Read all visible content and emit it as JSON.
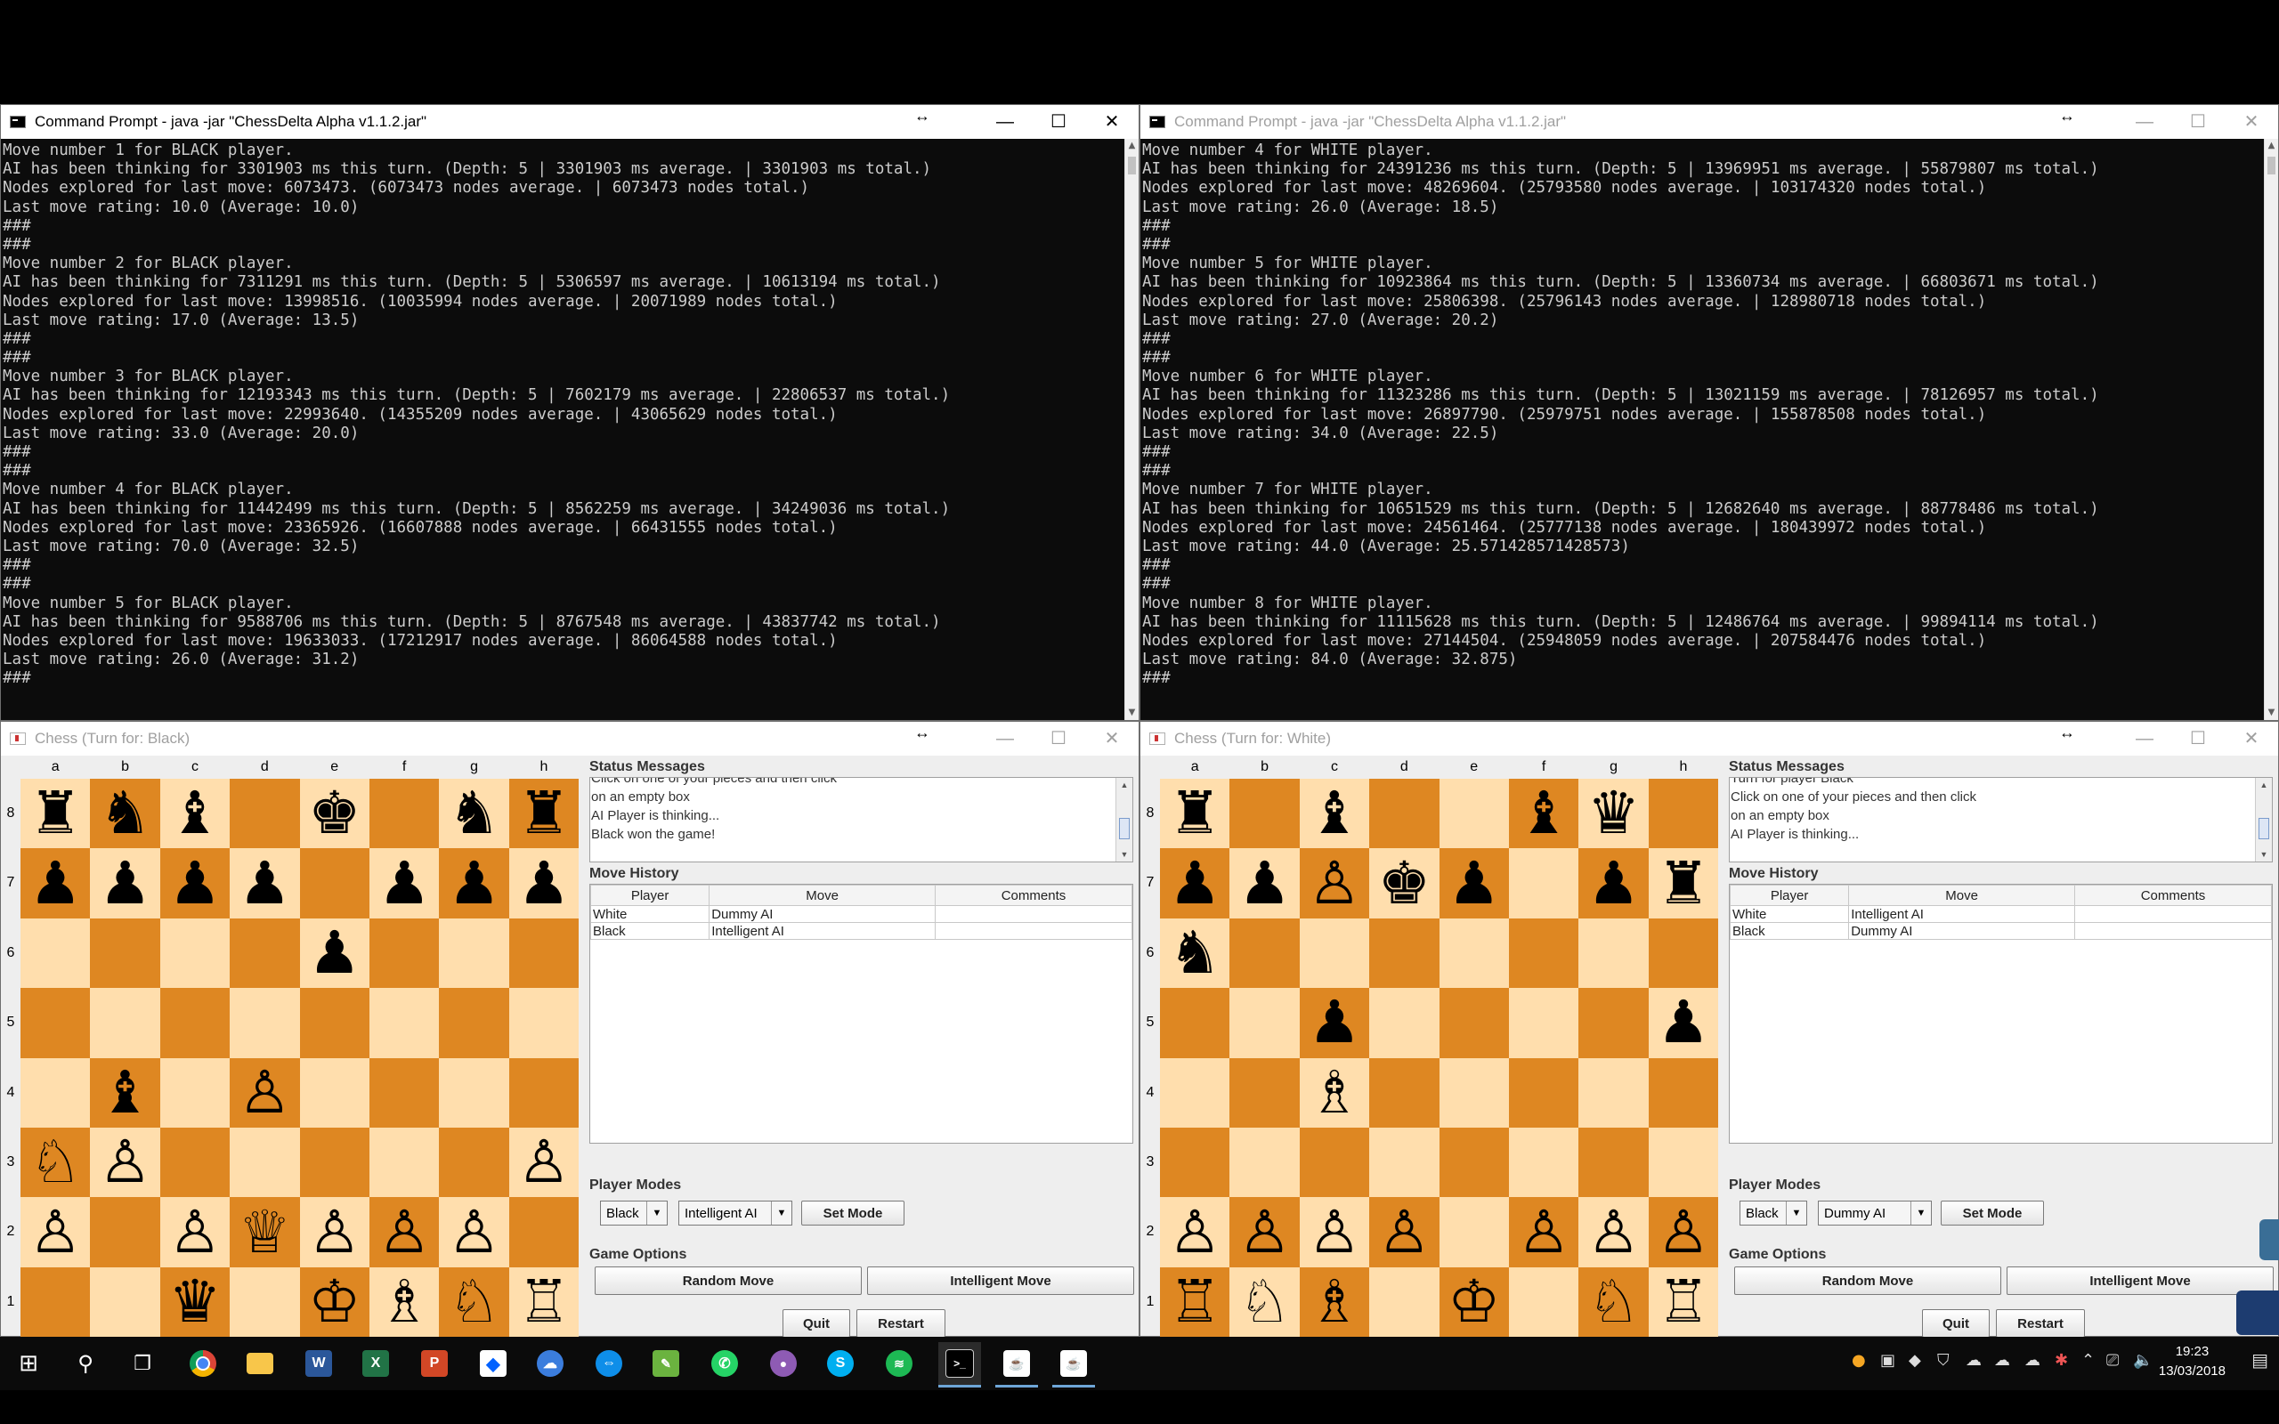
{
  "console_left": {
    "title": "Command Prompt - java  -jar \"ChessDelta Alpha v1.1.2.jar\"",
    "lines": [
      "Move number 1 for BLACK player.",
      "AI has been thinking for 3301903 ms this turn. (Depth: 5 | 3301903 ms average. | 3301903 ms total.)",
      "Nodes explored for last move: 6073473. (6073473 nodes average. | 6073473 nodes total.)",
      "Last move rating: 10.0 (Average: 10.0)",
      "###",
      "###",
      "Move number 2 for BLACK player.",
      "AI has been thinking for 7311291 ms this turn. (Depth: 5 | 5306597 ms average. | 10613194 ms total.)",
      "Nodes explored for last move: 13998516. (10035994 nodes average. | 20071989 nodes total.)",
      "Last move rating: 17.0 (Average: 13.5)",
      "###",
      "###",
      "Move number 3 for BLACK player.",
      "AI has been thinking for 12193343 ms this turn. (Depth: 5 | 7602179 ms average. | 22806537 ms total.)",
      "Nodes explored for last move: 22993640. (14355209 nodes average. | 43065629 nodes total.)",
      "Last move rating: 33.0 (Average: 20.0)",
      "###",
      "###",
      "Move number 4 for BLACK player.",
      "AI has been thinking for 11442499 ms this turn. (Depth: 5 | 8562259 ms average. | 34249036 ms total.)",
      "Nodes explored for last move: 23365926. (16607888 nodes average. | 66431555 nodes total.)",
      "Last move rating: 70.0 (Average: 32.5)",
      "###",
      "###",
      "Move number 5 for BLACK player.",
      "AI has been thinking for 9588706 ms this turn. (Depth: 5 | 8767548 ms average. | 43837742 ms total.)",
      "Nodes explored for last move: 19633033. (17212917 nodes average. | 86064588 nodes total.)",
      "Last move rating: 26.0 (Average: 31.2)",
      "###"
    ]
  },
  "console_right": {
    "title": "Command Prompt - java  -jar \"ChessDelta Alpha v1.1.2.jar\"",
    "lines": [
      "Move number 4 for WHITE player.",
      "AI has been thinking for 24391236 ms this turn. (Depth: 5 | 13969951 ms average. | 55879807 ms total.)",
      "Nodes explored for last move: 48269604. (25793580 nodes average. | 103174320 nodes total.)",
      "Last move rating: 26.0 (Average: 18.5)",
      "###",
      "###",
      "Move number 5 for WHITE player.",
      "AI has been thinking for 10923864 ms this turn. (Depth: 5 | 13360734 ms average. | 66803671 ms total.)",
      "Nodes explored for last move: 25806398. (25796143 nodes average. | 128980718 nodes total.)",
      "Last move rating: 27.0 (Average: 20.2)",
      "###",
      "###",
      "Move number 6 for WHITE player.",
      "AI has been thinking for 11323286 ms this turn. (Depth: 5 | 13021159 ms average. | 78126957 ms total.)",
      "Nodes explored for last move: 26897790. (25979751 nodes average. | 155878508 nodes total.)",
      "Last move rating: 34.0 (Average: 22.5)",
      "###",
      "###",
      "Move number 7 for WHITE player.",
      "AI has been thinking for 10651529 ms this turn. (Depth: 5 | 12682640 ms average. | 88778486 ms total.)",
      "Nodes explored for last move: 24561464. (25777138 nodes average. | 180439972 nodes total.)",
      "Last move rating: 44.0 (Average: 25.571428571428573)",
      "###",
      "###",
      "Move number 8 for WHITE player.",
      "AI has been thinking for 11115628 ms this turn. (Depth: 5 | 12486764 ms average. | 99894114 ms total.)",
      "Nodes explored for last move: 27144504. (25948059 nodes average. | 207584476 nodes total.)",
      "Last move rating: 84.0 (Average: 32.875)",
      "###"
    ]
  },
  "files": [
    "a",
    "b",
    "c",
    "d",
    "e",
    "f",
    "g",
    "h"
  ],
  "ranks": [
    "8",
    "7",
    "6",
    "5",
    "4",
    "3",
    "2",
    "1"
  ],
  "chess_left": {
    "title": "Chess (Turn for: Black)",
    "board": [
      [
        "♜",
        "♞",
        "♝",
        "",
        "♚",
        "",
        "♞",
        "♜"
      ],
      [
        "♟",
        "♟",
        "♟",
        "♟",
        "",
        "♟",
        "♟",
        "♟"
      ],
      [
        "",
        "",
        "",
        "",
        "♟",
        "",
        "",
        ""
      ],
      [
        "",
        "",
        "",
        "",
        "",
        "",
        "",
        ""
      ],
      [
        "",
        "♝",
        "",
        "♙",
        "",
        "",
        "",
        ""
      ],
      [
        "♘",
        "♙",
        "",
        "",
        "",
        "",
        "",
        "♙"
      ],
      [
        "♙",
        "",
        "♙",
        "♕",
        "♙",
        "♙",
        "♙",
        ""
      ],
      [
        "",
        "",
        "♛",
        "",
        "♔",
        "♗",
        "♘",
        "♖"
      ]
    ],
    "status_title": "Status Messages",
    "status_messages": [
      "Click on one of your pieces and then click",
      "on an empty box",
      "AI Player is thinking...",
      "Black won the game!"
    ],
    "history_title": "Move History",
    "history_headers": [
      "Player",
      "Move",
      "Comments"
    ],
    "history_rows": [
      [
        "White",
        "Dummy AI",
        ""
      ],
      [
        "Black",
        "Intelligent AI",
        ""
      ]
    ],
    "player_modes_title": "Player Modes",
    "player_select": "Black",
    "mode_select": "Intelligent AI",
    "set_mode": "Set Mode",
    "game_options_title": "Game Options",
    "random_move": "Random Move",
    "intelligent_move": "Intelligent Move",
    "quit": "Quit",
    "restart": "Restart"
  },
  "chess_right": {
    "title": "Chess (Turn for: White)",
    "board": [
      [
        "♜",
        "",
        "♝",
        "",
        "",
        "♝",
        "♛",
        ""
      ],
      [
        "♟",
        "♟",
        "♙",
        "♚",
        "♟",
        "",
        "♟",
        "♜"
      ],
      [
        "♞",
        "",
        "",
        "",
        "",
        "",
        "",
        ""
      ],
      [
        "",
        "",
        "♟",
        "",
        "",
        "",
        "",
        "♟"
      ],
      [
        "",
        "",
        "♗",
        "",
        "",
        "",
        "",
        ""
      ],
      [
        "",
        "",
        "",
        "",
        "",
        "",
        "",
        ""
      ],
      [
        "♙",
        "♙",
        "♙",
        "♙",
        "",
        "♙",
        "♙",
        "♙"
      ],
      [
        "♖",
        "♘",
        "♗",
        "",
        "♔",
        "",
        "♘",
        "♖"
      ]
    ],
    "status_title": "Status Messages",
    "status_messages": [
      "Turn for player Black",
      "Click on one of your pieces and then click",
      "on an empty box",
      "AI Player is thinking..."
    ],
    "history_title": "Move History",
    "history_headers": [
      "Player",
      "Move",
      "Comments"
    ],
    "history_rows": [
      [
        "White",
        "Intelligent AI",
        ""
      ],
      [
        "Black",
        "Dummy AI",
        ""
      ]
    ],
    "player_modes_title": "Player Modes",
    "player_select": "Black",
    "mode_select": "Dummy AI",
    "set_mode": "Set Mode",
    "game_options_title": "Game Options",
    "random_move": "Random Move",
    "intelligent_move": "Intelligent Move",
    "quit": "Quit",
    "restart": "Restart"
  },
  "taskbar": {
    "apps": [
      "windows-start",
      "search",
      "task-view",
      "chrome",
      "file-explorer",
      "word",
      "excel",
      "powerpoint",
      "dropbox",
      "cloud",
      "teamviewer",
      "notepad",
      "whatsapp",
      "app",
      "skype",
      "spotify",
      "command-prompt",
      "java-chess-1",
      "java-chess-2"
    ],
    "time": "19:23",
    "date": "13/03/2018"
  }
}
